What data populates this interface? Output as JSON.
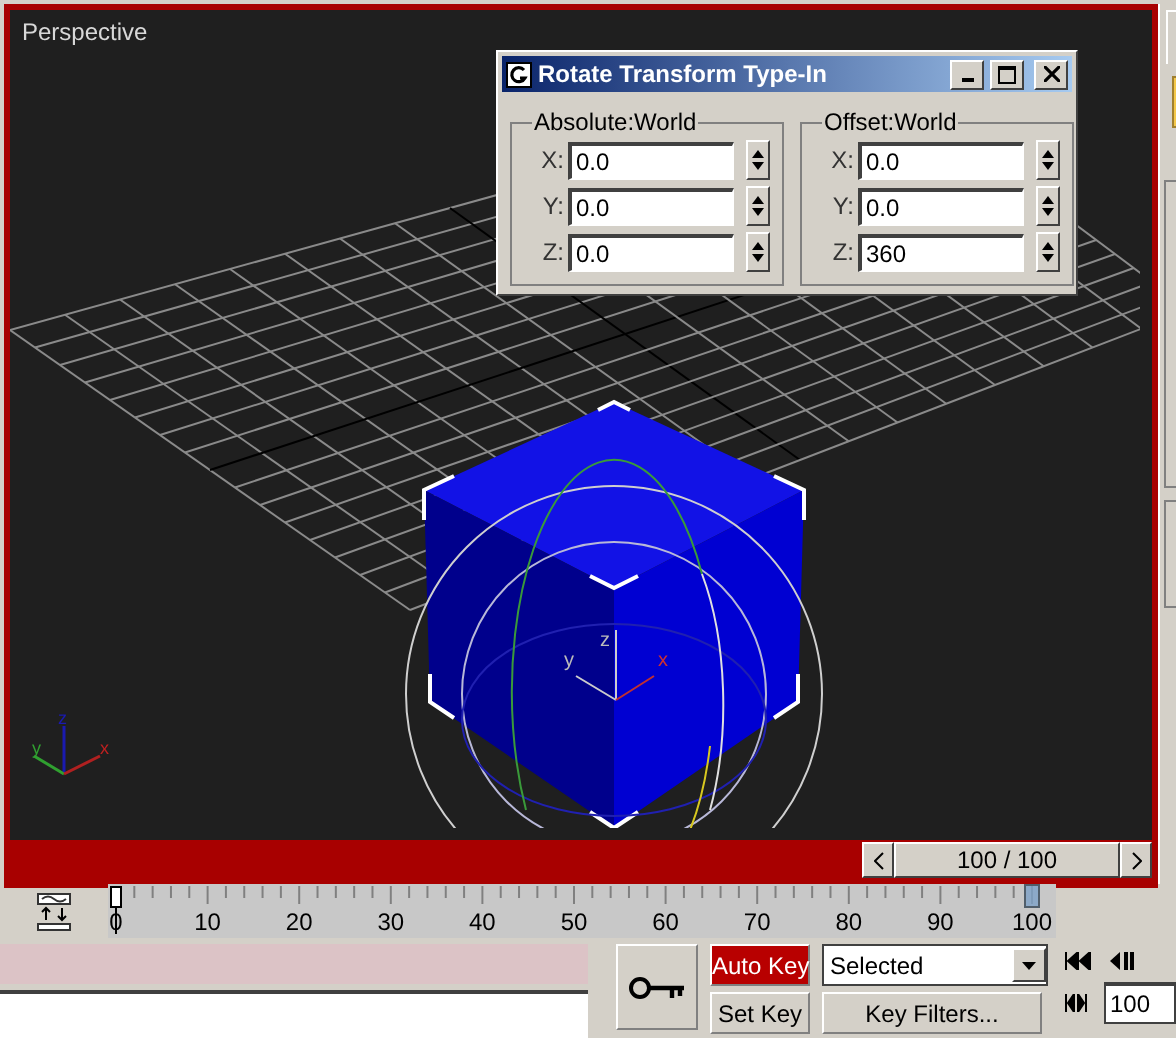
{
  "viewport": {
    "label": "Perspective",
    "active": true,
    "gizmo_axes": [
      "x",
      "y",
      "z"
    ],
    "corner_axes": [
      "x",
      "y",
      "z"
    ]
  },
  "dialog": {
    "title": "Rotate Transform Type-In",
    "groups": [
      {
        "title": "Absolute:World",
        "fields": [
          {
            "label": "X:",
            "value": "0.0"
          },
          {
            "label": "Y:",
            "value": "0.0"
          },
          {
            "label": "Z:",
            "value": "0.0"
          }
        ]
      },
      {
        "title": "Offset:World",
        "fields": [
          {
            "label": "X:",
            "value": "0.0"
          },
          {
            "label": "Y:",
            "value": "0.0"
          },
          {
            "label": "Z:",
            "value": "360"
          }
        ]
      }
    ]
  },
  "time_slider": {
    "position": "100 / 100"
  },
  "timeline": {
    "ticks": [
      "0",
      "10",
      "20",
      "30",
      "40",
      "50",
      "60",
      "70",
      "80",
      "90",
      "100"
    ],
    "level": 1
  },
  "animation": {
    "auto_key": {
      "label": "Auto Key",
      "on": true
    },
    "set_key": "Set Key",
    "key_mode": "Selected",
    "key_filters": "Key Filters...",
    "frame": "100"
  }
}
